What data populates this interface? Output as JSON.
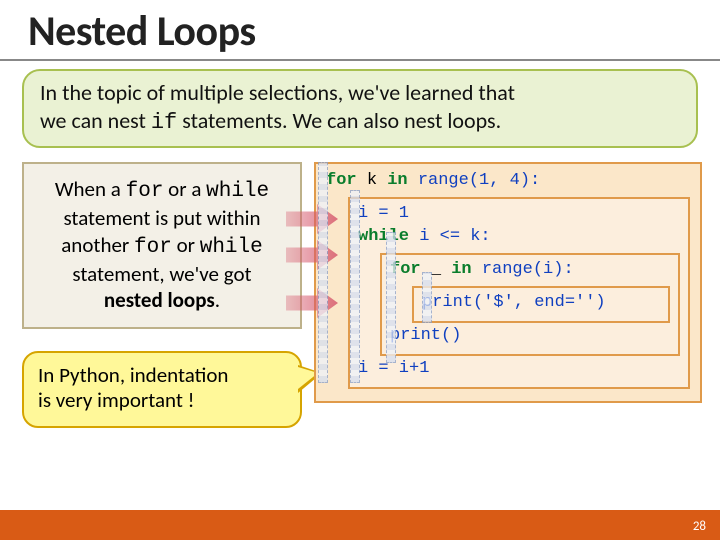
{
  "title": "Nested Loops",
  "intro": {
    "line1": "In the topic of multiple selections, we've learned that",
    "line2a": "we can nest ",
    "line2_code": "if",
    "line2b": " statements. We can also nest loops."
  },
  "definition": {
    "l1a": "When a ",
    "l1_for": "for",
    "l1b": " or a ",
    "l1_while": "while",
    "l2": "statement is put within",
    "l3a": "another ",
    "l3_for": "for",
    "l3b": " or ",
    "l3_while": "while",
    "l4": "statement, we've got",
    "l5": "nested loops"
  },
  "callout": {
    "line1": "In Python, indentation",
    "line2": "is very important !"
  },
  "code": {
    "kw_for": "for",
    "kw_in": "in",
    "kw_while": "while",
    "var_k": "k",
    "var_i": "i",
    "var_underscore": "_",
    "fn_range": "range",
    "fn_print": "print",
    "num_1": "1",
    "num_4": "4",
    "assign_i1": "i = 1",
    "cond": "i <= k:",
    "range_i": "range(i):",
    "print_dollar": "print('$', end='')",
    "print_empty": "print()",
    "incr": "i = i+1",
    "outer_header_tail": " range(1, 4):"
  },
  "page_number": "28"
}
